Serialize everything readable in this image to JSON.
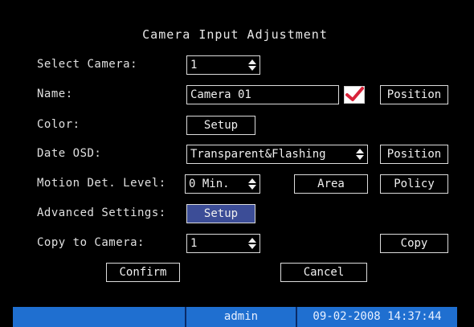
{
  "title": "Camera Input Adjustment",
  "fields": {
    "select_camera": {
      "label": "Select Camera:",
      "value": "1"
    },
    "name": {
      "label": "Name:",
      "value": "Camera 01",
      "position_button": "Position"
    },
    "color": {
      "label": "Color:",
      "button": "Setup"
    },
    "date_osd": {
      "label": "Date OSD:",
      "value": "Transparent&Flashing",
      "position_button": "Position"
    },
    "motion": {
      "label": "Motion Det. Level:",
      "value": "0 Min.",
      "area_button": "Area",
      "policy_button": "Policy"
    },
    "advanced": {
      "label": "Advanced Settings:",
      "button": "Setup"
    },
    "copy_to": {
      "label": "Copy to Camera:",
      "value": "1",
      "button": "Copy"
    }
  },
  "buttons": {
    "confirm": "Confirm",
    "cancel": "Cancel"
  },
  "status": {
    "user": "admin",
    "datetime": "09-02-2008 14:37:44"
  },
  "colors": {
    "background": "#000000",
    "statusbar": "#1f6fd0",
    "checkmark": "#d8233a",
    "selected": "#3c4d97"
  }
}
